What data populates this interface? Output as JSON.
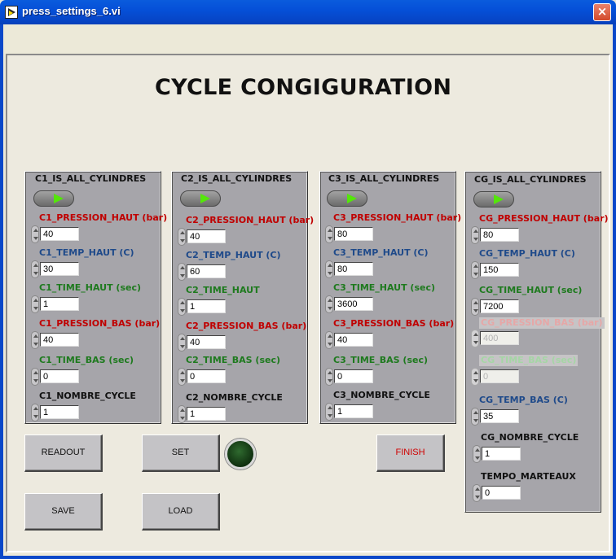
{
  "window": {
    "title": "press_settings_6.vi",
    "close_glyph": "×"
  },
  "page": {
    "title": "CYCLE CONGIGURATION"
  },
  "clusters": {
    "c1": {
      "header": "C1_IS_ALL_CYLINDRES",
      "f1_label": "C1_PRESSION_HAUT (bar)",
      "f1_value": "40",
      "f2_label": "C1_TEMP_HAUT (C)",
      "f2_value": "30",
      "f3_label": "C1_TIME_HAUT (sec)",
      "f3_value": "1",
      "f4_label": "C1_PRESSION_BAS (bar)",
      "f4_value": "40",
      "f5_label": "C1_TIME_BAS (sec)",
      "f5_value": "0",
      "f6_label": "C1_NOMBRE_CYCLE",
      "f6_value": "1"
    },
    "c2": {
      "header": "C2_IS_ALL_CYLINDRES",
      "f1_label": "C2_PRESSION_HAUT (bar)",
      "f1_value": "40",
      "f2_label": "C2_TEMP_HAUT (C)",
      "f2_value": "60",
      "f3_label": "C2_TIME_HAUT",
      "f3_value": "1",
      "f4_label": "C2_PRESSION_BAS (bar)",
      "f4_value": "40",
      "f5_label": "C2_TIME_BAS (sec)",
      "f5_value": "0",
      "f6_label": "C2_NOMBRE_CYCLE",
      "f6_value": "1"
    },
    "c3": {
      "header": "C3_IS_ALL_CYLINDRES",
      "f1_label": "C3_PRESSION_HAUT (bar)",
      "f1_value": "80",
      "f2_label": "C3_TEMP_HAUT (C)",
      "f2_value": "80",
      "f3_label": "C3_TIME_HAUT (sec)",
      "f3_value": "3600",
      "f4_label": "C3_PRESSION_BAS (bar)",
      "f4_value": "40",
      "f5_label": "C3_TIME_BAS (sec)",
      "f5_value": "0",
      "f6_label": "C3_NOMBRE_CYCLE",
      "f6_value": "1"
    },
    "cg": {
      "header": "CG_IS_ALL_CYLINDRES",
      "f1_label": "CG_PRESSION_HAUT (bar)",
      "f1_value": "80",
      "f2_label": "CG_TEMP_HAUT (C)",
      "f2_value": "150",
      "f3_label": "CG_TIME_HAUT (sec)",
      "f3_value": "7200",
      "f4_label": "CG_PRESSION_BAS (bar)",
      "f4_value": "400",
      "f5_label": "CG_TIME_BAS (sec)",
      "f5_value": "0",
      "f6_label": "CG_TEMP_BAS (C)",
      "f6_value": "35",
      "f7_label": "CG_NOMBRE_CYCLE",
      "f7_value": "1",
      "f8_label": "TEMPO_MARTEAUX",
      "f8_value": "0"
    }
  },
  "buttons": {
    "readout": "READOUT",
    "set": "SET",
    "finish": "FINISH",
    "save": "SAVE",
    "load": "LOAD"
  },
  "colors": {
    "pressure_label": "#C00000",
    "temp_label": "#1F4A8A",
    "time_label": "#1E7A1E",
    "toggle_arrow": "#54E60A",
    "finish_text": "#D00000"
  }
}
